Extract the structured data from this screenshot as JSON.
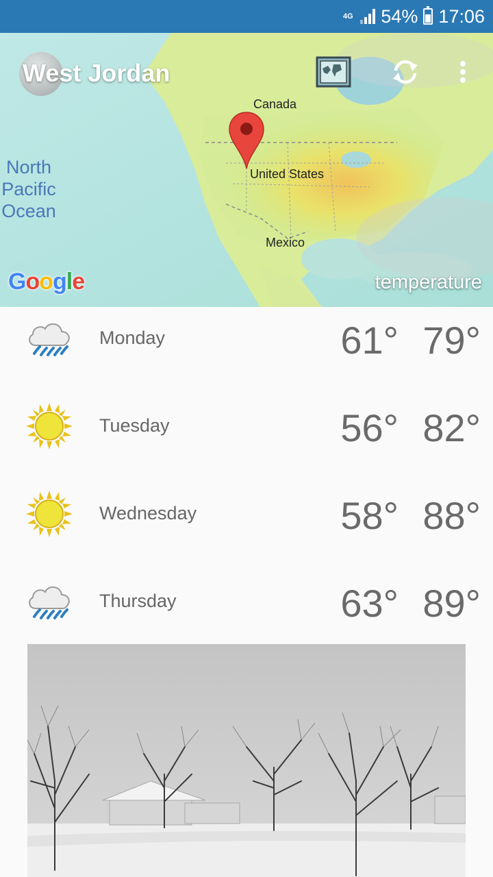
{
  "status_bar": {
    "network": "4G",
    "battery": "54%",
    "time": "17:06"
  },
  "toolbar": {
    "city": "West Jordan",
    "icons": [
      "map-layers-icon",
      "refresh-icon",
      "more-vert-icon"
    ]
  },
  "map": {
    "labels": {
      "canada": "Canada",
      "us": "United States",
      "mexico": "Mexico",
      "ocean_line1": "North",
      "ocean_line2": "Pacific",
      "ocean_line3": "Ocean"
    },
    "attribution": "Google",
    "layer": "temperature"
  },
  "forecast": [
    {
      "day": "Monday",
      "low": "61°",
      "high": "79°",
      "icon": "rain-icon"
    },
    {
      "day": "Tuesday",
      "low": "56°",
      "high": "82°",
      "icon": "sun-icon"
    },
    {
      "day": "Wednesday",
      "low": "58°",
      "high": "88°",
      "icon": "sun-icon"
    },
    {
      "day": "Thursday",
      "low": "63°",
      "high": "89°",
      "icon": "rain-icon"
    }
  ],
  "colors": {
    "status_bar": "#2a79b4",
    "marker": "#e8453c",
    "text_gray": "#6a6a6a"
  }
}
